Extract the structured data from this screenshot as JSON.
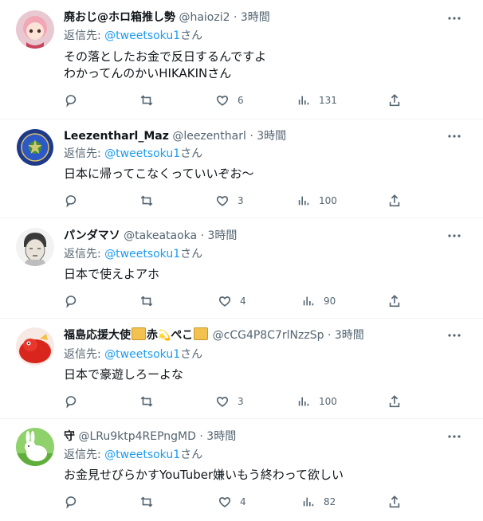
{
  "tweets": [
    {
      "name": "廃おじ@ホロ箱推し勢",
      "handle": "@haiozi2",
      "time": "3時間",
      "reply_prefix": "返信先: ",
      "reply_to": "@tweetsoku1",
      "reply_suffix": "さん",
      "lines": [
        "その落としたお金で反日するんですよ",
        "わかってんのかいHIKAKINさん"
      ],
      "likes": "6",
      "views": "131"
    },
    {
      "name": "Leezentharl_Maz",
      "handle": "@leezentharl",
      "time": "3時間",
      "reply_prefix": "返信先: ",
      "reply_to": "@tweetsoku1",
      "reply_suffix": "さん",
      "lines": [
        "日本に帰ってこなくっていいぞお～"
      ],
      "likes": "3",
      "views": "100"
    },
    {
      "name": "パンダマソ",
      "handle": "@takeataoka",
      "time": "3時間",
      "reply_prefix": "返信先: ",
      "reply_to": "@tweetsoku1",
      "reply_suffix": "さん",
      "lines": [
        "日本で使えよアホ"
      ],
      "likes": "4",
      "views": "90"
    },
    {
      "name_a": "福島応援大使",
      "name_b": "赤",
      "name_c": "ぺこ",
      "handle": "@cCG4P8C7rlNzzSp",
      "time": "3時間",
      "reply_prefix": "返信先: ",
      "reply_to": "@tweetsoku1",
      "reply_suffix": "さん",
      "lines": [
        "日本で豪遊しろーよな"
      ],
      "likes": "3",
      "views": "100"
    },
    {
      "name": "守",
      "handle": "@LRu9ktp4REPngMD",
      "time": "3時間",
      "reply_prefix": "返信先: ",
      "reply_to": "@tweetsoku1",
      "reply_suffix": "さん",
      "lines": [
        "お金見せびらかすYouTuber嫌いもう終わって欲しい"
      ],
      "likes": "4",
      "views": "82"
    }
  ],
  "dot_sep": "·",
  "icons": {
    "more": "more-horizontal-icon",
    "reply": "reply-icon",
    "retweet": "retweet-icon",
    "like": "heart-icon",
    "views": "analytics-icon",
    "share": "share-icon"
  },
  "colors": {
    "link": "#1d9bf0",
    "secondary": "#536471",
    "text": "#0f1419",
    "divider": "#eff3f4"
  }
}
